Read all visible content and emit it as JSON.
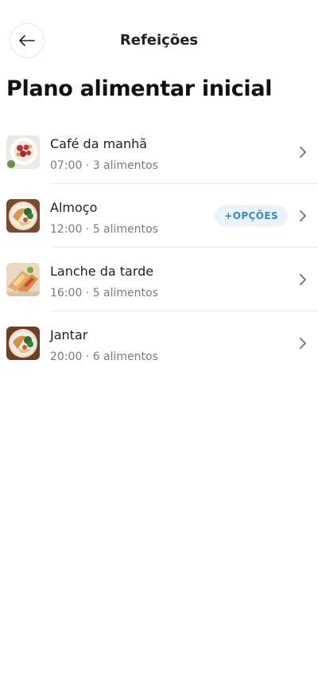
{
  "header": {
    "back_icon": "arrow-left-icon",
    "title": "Refeições"
  },
  "page": {
    "title": "Plano alimentar inicial"
  },
  "meals": [
    {
      "name": "Café da manhã",
      "meta": "07:00 · 3 alimentos",
      "image": "breakfast-bowl-photo"
    },
    {
      "name": "Almoço",
      "meta": "12:00 · 5 alimentos",
      "options_label": "+OPÇÕES",
      "image": "lunch-plate-photo"
    },
    {
      "name": "Lanche da tarde",
      "meta": "16:00 · 5 alimentos",
      "image": "wraps-photo"
    },
    {
      "name": "Jantar",
      "meta": "20:00 · 6 alimentos",
      "image": "dinner-plate-photo"
    }
  ],
  "colors": {
    "accent": "#3a86c8",
    "pill_bg": "#eaf3fc",
    "meta_text": "#7a7a7a",
    "chevron": "#7d7d7d"
  }
}
